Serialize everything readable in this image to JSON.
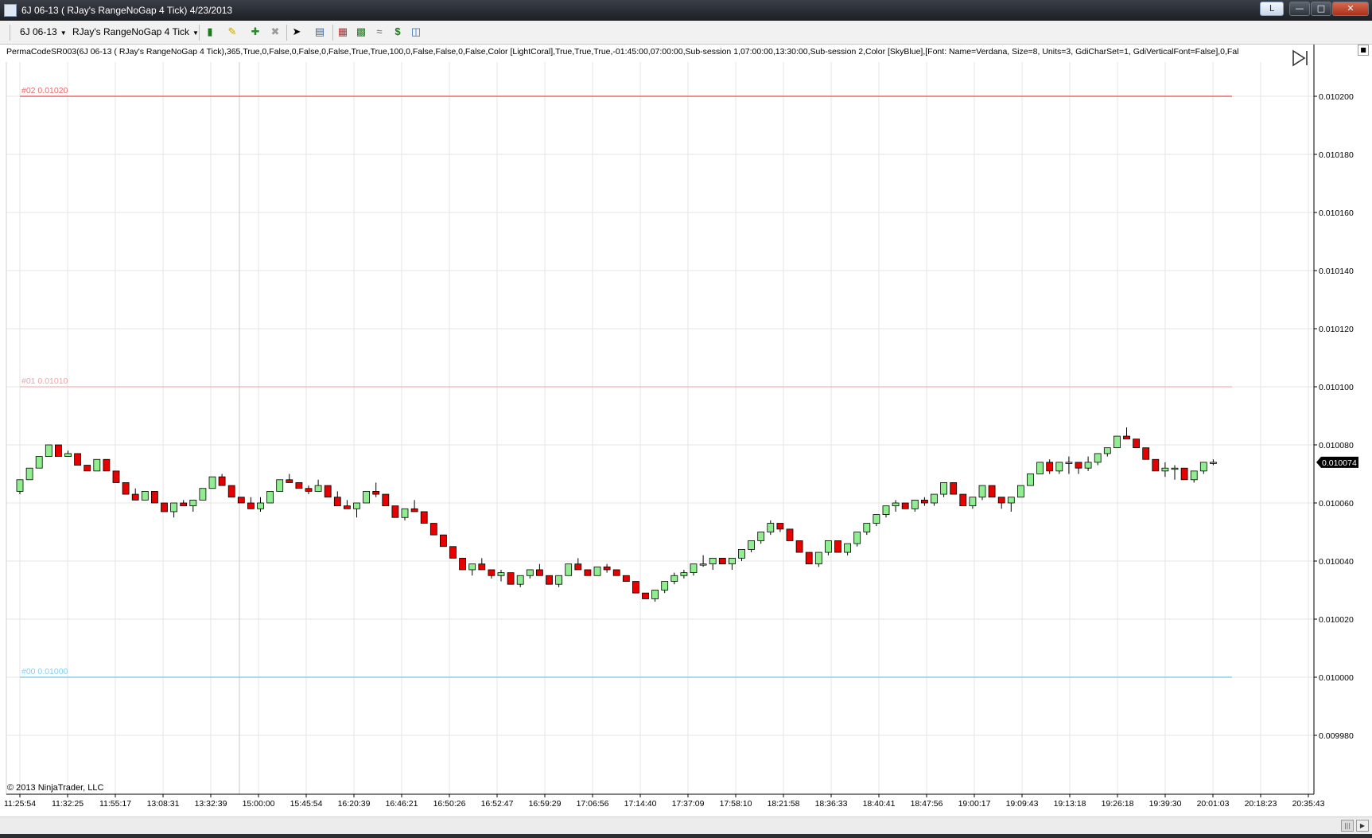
{
  "window": {
    "title": "6J 06-13 ( RJay's RangeNoGap  4 Tick)  4/23/2013",
    "minimize_icon": "minimize-icon",
    "maximize_icon": "maximize-icon",
    "close_icon": "close-icon",
    "link_button_label": "L"
  },
  "toolbar": {
    "instrument": "6J 06-13",
    "period": "RJay's RangeNoGap  4 Tick",
    "icons": [
      "candlestick-style-icon",
      "pencil-draw-icon",
      "zoom-in-icon",
      "zoom-out-icon",
      "cursor-icon",
      "data-box-icon",
      "bar-type-icon",
      "indicators-icon",
      "strategies-icon",
      "dollar-icon",
      "properties-icon"
    ]
  },
  "indicator_label": "PermaCodeSR003(6J 06-13 ( RJay's RangeNoGap  4 Tick),365,True,0,False,0,False,0,False,True,True,100,0,False,False,0,False,Color [LightCoral],True,True,True,-01:45:00,07:00:00,Sub-session 1,07:00:00,13:30:00,Sub-session 2,Color [SkyBlue],[Font: Name=Verdana, Size=8, Units=3, GdiCharSet=1, GdiVerticalFont=False],0,Fal",
  "copyright": "© 2013 NinjaTrader, LLC",
  "colors": {
    "up_candle": "#90ee90",
    "down_candle": "#e60000",
    "candle_outline": "#000000",
    "grid": "#e6e6e6",
    "level_red": "#e8686b",
    "level_red_faint": "#f0a0a5",
    "level_blue": "#87ceeb",
    "price_marker_bg": "#000000",
    "price_marker_text": "#ffffff"
  },
  "chart_data": {
    "type": "candlestick",
    "y_range": [
      0.00996,
      0.01022
    ],
    "y_ticks": [
      "0.010200",
      "0.010180",
      "0.010160",
      "0.010140",
      "0.010120",
      "0.010100",
      "0.010080",
      "0.010060",
      "0.010040",
      "0.010020",
      "0.010000",
      "0.009980"
    ],
    "y_tick_values": [
      0.0102,
      0.01018,
      0.01016,
      0.01014,
      0.01012,
      0.0101,
      0.01008,
      0.01006,
      0.01004,
      0.01002,
      0.01,
      0.00998
    ],
    "x_ticks": [
      "11:25:54",
      "11:32:25",
      "11:55:17",
      "13:08:31",
      "13:32:39",
      "15:00:00",
      "15:45:54",
      "16:20:39",
      "16:46:21",
      "16:50:26",
      "16:52:47",
      "16:59:29",
      "17:06:56",
      "17:14:40",
      "17:37:09",
      "17:58:10",
      "18:21:58",
      "18:36:33",
      "18:40:41",
      "18:47:56",
      "19:00:17",
      "19:09:43",
      "19:13:18",
      "19:26:18",
      "19:39:30",
      "20:01:03",
      "20:18:23",
      "20:35:43"
    ],
    "session_break_label": "15:00:00",
    "last_price": "0.010074",
    "levels": [
      {
        "label": "#02 0.01020",
        "value": 0.0102,
        "color": "#e8686b"
      },
      {
        "label": "#01 0.01010",
        "value": 0.0101,
        "color": "#f0a0a5"
      },
      {
        "label": "#00 0.01000",
        "value": 0.01,
        "color": "#87ceeb"
      }
    ],
    "candles": [
      [
        0.010064,
        0.010068,
        0.010063,
        0.010068
      ],
      [
        0.010068,
        0.010072,
        0.010068,
        0.010072
      ],
      [
        0.010072,
        0.010076,
        0.010072,
        0.010076
      ],
      [
        0.010076,
        0.01008,
        0.010076,
        0.01008
      ],
      [
        0.01008,
        0.01008,
        0.010076,
        0.010076
      ],
      [
        0.010076,
        0.010078,
        0.010076,
        0.010077
      ],
      [
        0.010077,
        0.010077,
        0.010073,
        0.010073
      ],
      [
        0.010073,
        0.010073,
        0.010071,
        0.010071
      ],
      [
        0.010071,
        0.010075,
        0.010071,
        0.010075
      ],
      [
        0.010075,
        0.010075,
        0.010071,
        0.010071
      ],
      [
        0.010071,
        0.010071,
        0.010067,
        0.010067
      ],
      [
        0.010067,
        0.010067,
        0.010063,
        0.010063
      ],
      [
        0.010063,
        0.010065,
        0.010061,
        0.010061
      ],
      [
        0.010061,
        0.010064,
        0.010061,
        0.010064
      ],
      [
        0.010064,
        0.010064,
        0.01006,
        0.01006
      ],
      [
        0.01006,
        0.01006,
        0.010057,
        0.010057
      ],
      [
        0.010057,
        0.01006,
        0.010055,
        0.01006
      ],
      [
        0.01006,
        0.010061,
        0.010059,
        0.010059
      ],
      [
        0.010059,
        0.010061,
        0.010057,
        0.010061
      ],
      [
        0.010061,
        0.010065,
        0.010061,
        0.010065
      ],
      [
        0.010065,
        0.010069,
        0.010065,
        0.010069
      ],
      [
        0.010069,
        0.01007,
        0.010066,
        0.010066
      ],
      [
        0.010066,
        0.010066,
        0.010062,
        0.010062
      ],
      [
        0.010062,
        0.010062,
        0.01006,
        0.01006
      ],
      [
        0.01006,
        0.010062,
        0.010058,
        0.010058
      ],
      [
        0.010058,
        0.010062,
        0.010057,
        0.01006
      ],
      [
        0.01006,
        0.010064,
        0.01006,
        0.010064
      ],
      [
        0.010064,
        0.010068,
        0.010064,
        0.010068
      ],
      [
        0.010068,
        0.01007,
        0.010067,
        0.010067
      ],
      [
        0.010067,
        0.010067,
        0.010065,
        0.010065
      ],
      [
        0.010065,
        0.010066,
        0.010063,
        0.010064
      ],
      [
        0.010064,
        0.010068,
        0.010064,
        0.010066
      ],
      [
        0.010066,
        0.010066,
        0.010062,
        0.010062
      ],
      [
        0.010062,
        0.010064,
        0.010059,
        0.010059
      ],
      [
        0.010059,
        0.010061,
        0.010058,
        0.010058
      ],
      [
        0.010058,
        0.01006,
        0.010055,
        0.01006
      ],
      [
        0.01006,
        0.010064,
        0.01006,
        0.010064
      ],
      [
        0.010064,
        0.010067,
        0.010062,
        0.010063
      ],
      [
        0.010063,
        0.010063,
        0.010059,
        0.010059
      ],
      [
        0.010059,
        0.010059,
        0.010055,
        0.010055
      ],
      [
        0.010055,
        0.010058,
        0.010054,
        0.010058
      ],
      [
        0.010058,
        0.010061,
        0.010057,
        0.010057
      ],
      [
        0.010057,
        0.010057,
        0.010053,
        0.010053
      ],
      [
        0.010053,
        0.010053,
        0.010049,
        0.010049
      ],
      [
        0.010049,
        0.010049,
        0.010045,
        0.010045
      ],
      [
        0.010045,
        0.010045,
        0.010041,
        0.010041
      ],
      [
        0.010041,
        0.010041,
        0.010037,
        0.010037
      ],
      [
        0.010037,
        0.010039,
        0.010035,
        0.010039
      ],
      [
        0.010039,
        0.010041,
        0.010037,
        0.010037
      ],
      [
        0.010037,
        0.010037,
        0.010034,
        0.010035
      ],
      [
        0.010035,
        0.010037,
        0.010033,
        0.010036
      ],
      [
        0.010036,
        0.010036,
        0.010032,
        0.010032
      ],
      [
        0.010032,
        0.010035,
        0.010031,
        0.010035
      ],
      [
        0.010035,
        0.010037,
        0.010034,
        0.010037
      ],
      [
        0.010037,
        0.010039,
        0.010035,
        0.010035
      ],
      [
        0.010035,
        0.010035,
        0.010032,
        0.010032
      ],
      [
        0.010032,
        0.010035,
        0.010031,
        0.010035
      ],
      [
        0.010035,
        0.010039,
        0.010035,
        0.010039
      ],
      [
        0.010039,
        0.010041,
        0.010037,
        0.010037
      ],
      [
        0.010037,
        0.010037,
        0.010035,
        0.010035
      ],
      [
        0.010035,
        0.010038,
        0.010035,
        0.010038
      ],
      [
        0.010038,
        0.010039,
        0.010036,
        0.010037
      ],
      [
        0.010037,
        0.010037,
        0.010035,
        0.010035
      ],
      [
        0.010035,
        0.010035,
        0.010033,
        0.010033
      ],
      [
        0.010033,
        0.010033,
        0.010029,
        0.010029
      ],
      [
        0.010029,
        0.010029,
        0.010027,
        0.010027
      ],
      [
        0.010027,
        0.01003,
        0.010026,
        0.01003
      ],
      [
        0.01003,
        0.010033,
        0.010029,
        0.010033
      ],
      [
        0.010033,
        0.010036,
        0.010032,
        0.010035
      ],
      [
        0.010035,
        0.010037,
        0.010034,
        0.010036
      ],
      [
        0.010036,
        0.010039,
        0.010035,
        0.010039
      ],
      [
        0.010039,
        0.010042,
        0.010038,
        0.010039
      ],
      [
        0.010039,
        0.010041,
        0.010037,
        0.010041
      ],
      [
        0.010041,
        0.010041,
        0.010039,
        0.010039
      ],
      [
        0.010039,
        0.010041,
        0.010037,
        0.010041
      ],
      [
        0.010041,
        0.010044,
        0.01004,
        0.010044
      ],
      [
        0.010044,
        0.010047,
        0.010043,
        0.010047
      ],
      [
        0.010047,
        0.01005,
        0.010046,
        0.01005
      ],
      [
        0.01005,
        0.010054,
        0.010049,
        0.010053
      ],
      [
        0.010053,
        0.010053,
        0.01005,
        0.010051
      ],
      [
        0.010051,
        0.010051,
        0.010047,
        0.010047
      ],
      [
        0.010047,
        0.010047,
        0.010043,
        0.010043
      ],
      [
        0.010043,
        0.010043,
        0.010039,
        0.010039
      ],
      [
        0.010039,
        0.010043,
        0.010038,
        0.010043
      ],
      [
        0.010043,
        0.010047,
        0.010042,
        0.010047
      ],
      [
        0.010047,
        0.010047,
        0.010043,
        0.010043
      ],
      [
        0.010043,
        0.010046,
        0.010042,
        0.010046
      ],
      [
        0.010046,
        0.01005,
        0.010045,
        0.01005
      ],
      [
        0.01005,
        0.010053,
        0.010049,
        0.010053
      ],
      [
        0.010053,
        0.010056,
        0.010052,
        0.010056
      ],
      [
        0.010056,
        0.010059,
        0.010055,
        0.010059
      ],
      [
        0.010059,
        0.010061,
        0.010057,
        0.01006
      ],
      [
        0.01006,
        0.01006,
        0.010058,
        0.010058
      ],
      [
        0.010058,
        0.010061,
        0.010057,
        0.010061
      ],
      [
        0.010061,
        0.010062,
        0.010059,
        0.01006
      ],
      [
        0.01006,
        0.010063,
        0.010059,
        0.010063
      ],
      [
        0.010063,
        0.010067,
        0.010062,
        0.010067
      ],
      [
        0.010067,
        0.010067,
        0.010063,
        0.010063
      ],
      [
        0.010063,
        0.010063,
        0.010059,
        0.010059
      ],
      [
        0.010059,
        0.010062,
        0.010058,
        0.010062
      ],
      [
        0.010062,
        0.010066,
        0.010061,
        0.010066
      ],
      [
        0.010066,
        0.010066,
        0.010062,
        0.010062
      ],
      [
        0.010062,
        0.010062,
        0.010058,
        0.01006
      ],
      [
        0.01006,
        0.010062,
        0.010057,
        0.010062
      ],
      [
        0.010062,
        0.010066,
        0.010062,
        0.010066
      ],
      [
        0.010066,
        0.01007,
        0.010066,
        0.01007
      ],
      [
        0.01007,
        0.010074,
        0.01007,
        0.010074
      ],
      [
        0.010074,
        0.010075,
        0.01007,
        0.010071
      ],
      [
        0.010071,
        0.010074,
        0.01007,
        0.010074
      ],
      [
        0.010074,
        0.010076,
        0.01007,
        0.010074
      ],
      [
        0.010074,
        0.010074,
        0.01007,
        0.010072
      ],
      [
        0.010072,
        0.010076,
        0.010071,
        0.010074
      ],
      [
        0.010074,
        0.010077,
        0.010073,
        0.010077
      ],
      [
        0.010077,
        0.010079,
        0.010076,
        0.010079
      ],
      [
        0.010079,
        0.010083,
        0.010079,
        0.010083
      ],
      [
        0.010083,
        0.010086,
        0.010082,
        0.010082
      ],
      [
        0.010082,
        0.010082,
        0.010079,
        0.010079
      ],
      [
        0.010079,
        0.010079,
        0.010075,
        0.010075
      ],
      [
        0.010075,
        0.010075,
        0.010071,
        0.010071
      ],
      [
        0.010071,
        0.010074,
        0.010069,
        0.010072
      ],
      [
        0.010072,
        0.010073,
        0.010068,
        0.010072
      ],
      [
        0.010072,
        0.010072,
        0.010068,
        0.010068
      ],
      [
        0.010068,
        0.010071,
        0.010067,
        0.010071
      ],
      [
        0.010071,
        0.010074,
        0.01007,
        0.010074
      ],
      [
        0.010074,
        0.010075,
        0.010073,
        0.010074
      ]
    ]
  }
}
